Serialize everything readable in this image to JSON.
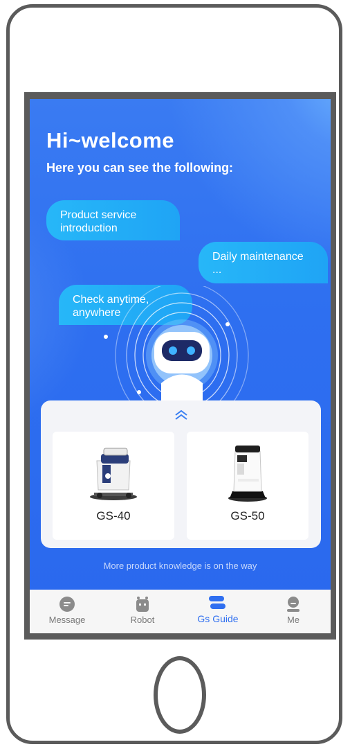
{
  "header": {
    "title": "Hi~welcome",
    "subtitle": "Here you can see the following:"
  },
  "bubbles": [
    {
      "text": "Product service introduction"
    },
    {
      "text": "Daily maintenance ..."
    },
    {
      "text": "Check anytime, anywhere"
    }
  ],
  "products": [
    {
      "name": "GS-40"
    },
    {
      "name": "GS-50"
    }
  ],
  "footer_note": "More product knowledge is on the way",
  "tabbar": {
    "active": "Gs Guide",
    "tabs": [
      {
        "label": "Message",
        "icon": "message-icon"
      },
      {
        "label": "Robot",
        "icon": "robot-icon"
      },
      {
        "label": "Gs Guide",
        "icon": "guide-icon"
      },
      {
        "label": "Me",
        "icon": "person-icon"
      }
    ]
  },
  "colors": {
    "primary": "#2f6ff0",
    "bubble": "#22aef7",
    "frame": "#5b5b5b"
  }
}
